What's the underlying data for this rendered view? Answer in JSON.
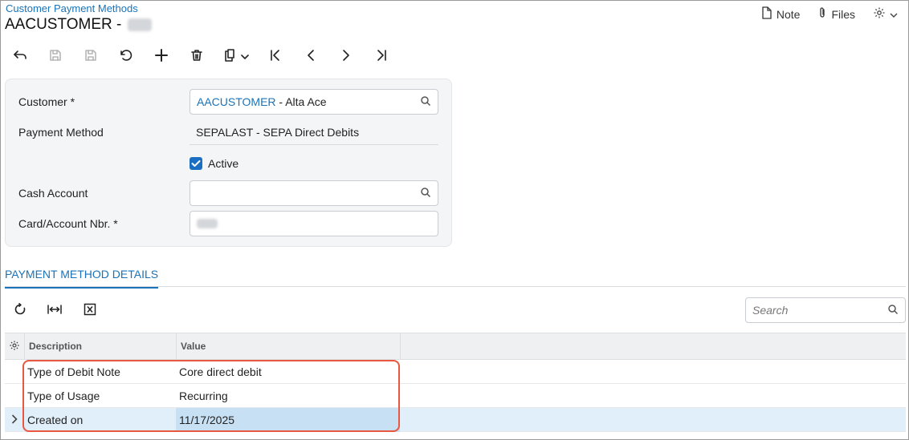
{
  "header": {
    "breadcrumb": "Customer Payment Methods",
    "title_prefix": "AACUSTOMER -",
    "note_label": "Note",
    "files_label": "Files"
  },
  "form": {
    "customer_label": "Customer",
    "customer_id": "AACUSTOMER",
    "customer_name": " - Alta Ace",
    "payment_method_label": "Payment Method",
    "payment_method_value": "SEPALAST - SEPA Direct Debits",
    "active_label": "Active",
    "active_checked": true,
    "cash_account_label": "Cash Account",
    "cash_account_value": "",
    "card_account_label": "Card/Account Nbr.",
    "required_marker": "*"
  },
  "tabs": [
    {
      "label": "PAYMENT METHOD DETAILS",
      "active": true
    }
  ],
  "grid": {
    "search_placeholder": "Search",
    "columns": [
      "Description",
      "Value"
    ],
    "rows": [
      {
        "description": "Type of Debit Note",
        "value": "Core direct debit"
      },
      {
        "description": "Type of Usage",
        "value": "Recurring"
      },
      {
        "description": "Created on",
        "value": "11/17/2025",
        "selected": true
      }
    ]
  },
  "colors": {
    "accent": "#1a73b8",
    "highlight_border": "#e8573f",
    "selected_row": "#e1effa",
    "selected_cell": "#c8e0f4"
  }
}
